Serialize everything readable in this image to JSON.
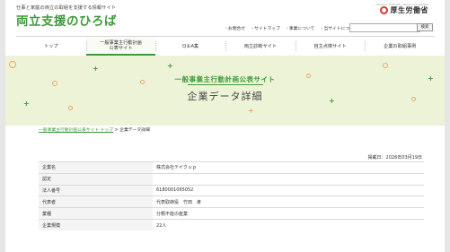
{
  "header": {
    "tagline": "仕事と家庭の両立の取組を支援する情報サイト",
    "logo": "両立支援のひろば",
    "ministry": {
      "name": "厚生労働省",
      "sub": "Ministry of Health, Labour and Welfare"
    }
  },
  "utility_links": [
    "お問合せ",
    "サイトマップ",
    "事業について",
    "当サイトについて"
  ],
  "search": {
    "placeholder": "",
    "button": "検索"
  },
  "nav": [
    {
      "label": "トップ",
      "active": false
    },
    {
      "label": "一般事業主行動計画\n公表サイト",
      "active": true
    },
    {
      "label": "Q＆A集",
      "active": false
    },
    {
      "label": "両立診断サイト",
      "active": false
    },
    {
      "label": "自主点検サイト",
      "active": false
    },
    {
      "label": "企業の取組事例",
      "active": false
    }
  ],
  "banner": {
    "subtitle": "一般事業主行動計画公表サイト",
    "title": "企業データ詳細"
  },
  "breadcrumb": {
    "link": "一般事業主行動計画公表サイト トップ",
    "separator": " > ",
    "current": "企業データ詳細"
  },
  "updated": "掲載日：2026年03月19日",
  "company_rows": [
    {
      "label": "企業名",
      "value": "株式会社テイクｕｐ"
    },
    {
      "label": "認定",
      "value": ""
    },
    {
      "label": "法人番号",
      "value": "6180001065052"
    },
    {
      "label": "代表者",
      "value": "代表取締役　竹田　孝"
    },
    {
      "label": "業種",
      "value": "分類不能の産業"
    },
    {
      "label": "企業規模",
      "value": "22人"
    }
  ],
  "colors": {
    "brand_green": "#3e9a3a",
    "banner_bg": "#edf3d7",
    "accent_orange": "#f0a56a",
    "ministry_red": "#d83a2e"
  }
}
